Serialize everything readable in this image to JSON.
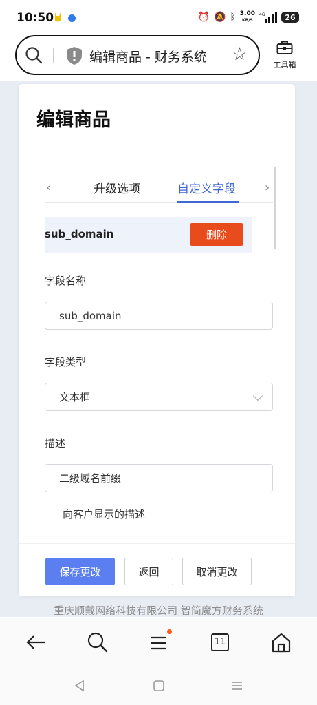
{
  "status_bar": {
    "time": "10:50",
    "speed_value": "3.00",
    "speed_unit": "KB/S",
    "network": "4G",
    "battery": "26"
  },
  "browser": {
    "page_title": "编辑商品 - 财务系统",
    "toolbox_label": "工具箱"
  },
  "page": {
    "title": "编辑商品",
    "tabs": [
      {
        "label": "升级选项",
        "active": false
      },
      {
        "label": "自定义字段",
        "active": true
      }
    ],
    "custom_field": {
      "header_name": "sub_domain",
      "delete_label": "删除",
      "name_label": "字段名称",
      "name_value": "sub_domain",
      "type_label": "字段类型",
      "type_value": "文本框",
      "desc_label": "描述",
      "desc_value": "二级域名前缀",
      "desc_hint": "向客户显示的描述"
    },
    "buttons": {
      "save": "保存更改",
      "back": "返回",
      "cancel": "取消更改"
    },
    "footer_company": "重庆顺戴网络科技有限公司 智简魔方财务系统"
  },
  "bottom_nav": {
    "tabs_count": "11"
  },
  "colors": {
    "accent": "#3f67d6",
    "primary_button": "#5b7ef0",
    "danger": "#e84b1c",
    "page_background": "#e8ecf3"
  }
}
